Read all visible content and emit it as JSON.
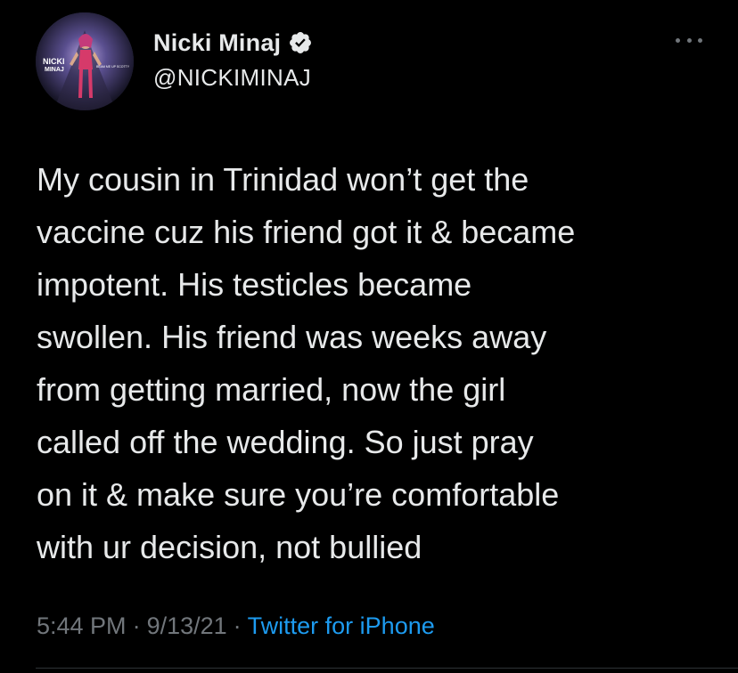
{
  "author": {
    "display_name": "Nicki Minaj",
    "handle": "@NICKIMINAJ",
    "verified": true,
    "avatar_icon": "profile-photo",
    "avatar_text": "NICKI MINAJ",
    "avatar_subtext": "BEAM ME UP SCOTTY"
  },
  "tweet": {
    "lines": [
      "My cousin in Trinidad won’t get the",
      "vaccine cuz his friend got it & became",
      "impotent. His testicles became",
      "swollen. His friend was weeks away",
      "from getting married, now the girl",
      "called off the wedding. So just pray",
      "on it & make sure you’re comfortable",
      "with ur decision, not bullied"
    ],
    "time": "5:44 PM",
    "date": "9/13/21",
    "source": "Twitter for iPhone",
    "separator": "·"
  },
  "colors": {
    "background": "#000000",
    "text": "#e7e9ea",
    "muted": "#71767b",
    "link": "#1d9bf0",
    "verified_badge": "#e7e9ea"
  },
  "icons": {
    "more": "more-dots-icon",
    "verified": "verified-badge-icon"
  }
}
